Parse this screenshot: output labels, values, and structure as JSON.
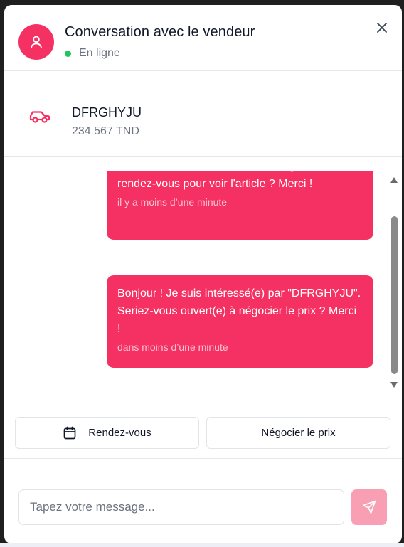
{
  "header": {
    "title": "Conversation avec le vendeur",
    "status": "En ligne",
    "avatar_icon": "user-icon",
    "close_icon": "close-icon"
  },
  "product": {
    "icon": "car-icon",
    "name": "DFRGHYJU",
    "price": "234 567 TND"
  },
  "messages": [
    {
      "text": "\"DFRGHYJU\". Pourriez-vous m'organiser un rendez-vous pour voir l'article ? Merci !",
      "time": "il y a moins d’une minute"
    },
    {
      "text": "Bonjour ! Je suis intéressé(e) par \"DFRGHYJU\". Seriez-vous ouvert(e) à négocier le prix ? Merci !",
      "time": "dans moins d’une minute"
    }
  ],
  "actions": {
    "appointment_label": "Rendez-vous",
    "appointment_icon": "calendar-icon",
    "negotiate_label": "Négocier le prix"
  },
  "composer": {
    "placeholder": "Tapez votre message...",
    "send_icon": "send-icon"
  },
  "colors": {
    "accent": "#f43162",
    "send_disabled": "#f89fb4",
    "online": "#22c55e"
  }
}
